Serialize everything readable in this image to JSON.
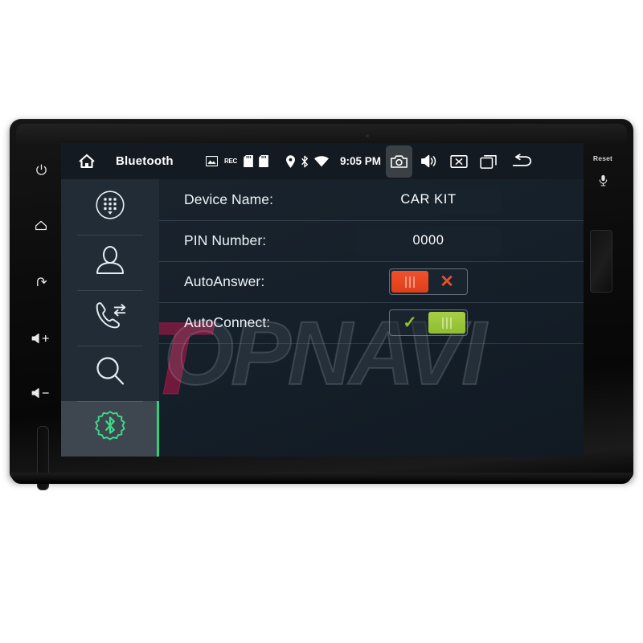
{
  "device": {
    "left_keys": [
      {
        "name": "power",
        "icon": "power-icon"
      },
      {
        "name": "home",
        "icon": "home-icon"
      },
      {
        "name": "back",
        "icon": "back-icon"
      },
      {
        "name": "volume-up",
        "icon": "volume-up-icon",
        "label": "+"
      },
      {
        "name": "volume-down",
        "icon": "volume-down-icon",
        "label": "−"
      }
    ],
    "right": {
      "reset_label": "Reset",
      "mic_icon": "microphone-icon"
    }
  },
  "statusbar": {
    "home_icon": "home-icon",
    "title": "Bluetooth",
    "indicators": [
      {
        "name": "photo-icon",
        "text": ""
      },
      {
        "name": "rec-icon",
        "text": "REC"
      },
      {
        "name": "sdcard1-icon",
        "text": ""
      },
      {
        "name": "sdcard2-icon",
        "text": ""
      },
      {
        "name": "location-icon",
        "text": ""
      },
      {
        "name": "bluetooth-icon",
        "text": ""
      },
      {
        "name": "wifi-icon",
        "text": ""
      }
    ],
    "time": "9:05 PM",
    "nav": [
      {
        "name": "screenshot-button",
        "icon": "camera-icon",
        "active": true
      },
      {
        "name": "volume-button",
        "icon": "speaker-icon",
        "active": false
      },
      {
        "name": "mute-button",
        "icon": "mute-box-icon",
        "active": false
      },
      {
        "name": "recents-button",
        "icon": "recents-icon",
        "active": false
      },
      {
        "name": "back-button",
        "icon": "back-arrow-icon",
        "active": false
      }
    ]
  },
  "sidebar": {
    "items": [
      {
        "name": "dialpad",
        "icon": "dialpad-icon",
        "active": false
      },
      {
        "name": "contacts",
        "icon": "contact-person-icon",
        "active": false
      },
      {
        "name": "call-history",
        "icon": "call-history-icon",
        "active": false
      },
      {
        "name": "search",
        "icon": "search-icon",
        "active": false
      },
      {
        "name": "bluetooth-settings",
        "icon": "bluetooth-gear-icon",
        "active": true
      }
    ],
    "accent_color": "#2fd07a"
  },
  "settings": {
    "rows": [
      {
        "label": "Device Name:",
        "type": "value",
        "value": "CAR KIT"
      },
      {
        "label": "PIN Number:",
        "type": "value",
        "value": "0000"
      },
      {
        "label": "AutoAnswer:",
        "type": "toggle",
        "state": "off",
        "off_mark": "✕",
        "color": "#e4512c"
      },
      {
        "label": "AutoConnect:",
        "type": "toggle",
        "state": "on",
        "on_mark": "✓",
        "color": "#8fbd30"
      }
    ]
  },
  "watermark": {
    "letter": "T",
    "text": "OPNAVI",
    "brand_color": "#a8164a"
  }
}
